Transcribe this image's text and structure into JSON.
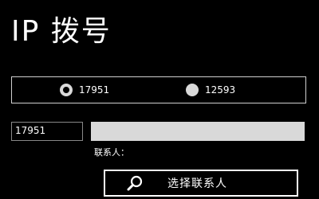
{
  "header": {
    "title": "IP 拨号"
  },
  "radio_group": {
    "options": [
      {
        "label": "17951",
        "selected": true
      },
      {
        "label": "12593",
        "selected": false
      }
    ]
  },
  "prefix_box": {
    "value": "17951"
  },
  "number_input": {
    "value": ""
  },
  "contact": {
    "label": "联系人："
  },
  "select_contact": {
    "label": "选择联系人",
    "icon": "search-icon"
  }
}
